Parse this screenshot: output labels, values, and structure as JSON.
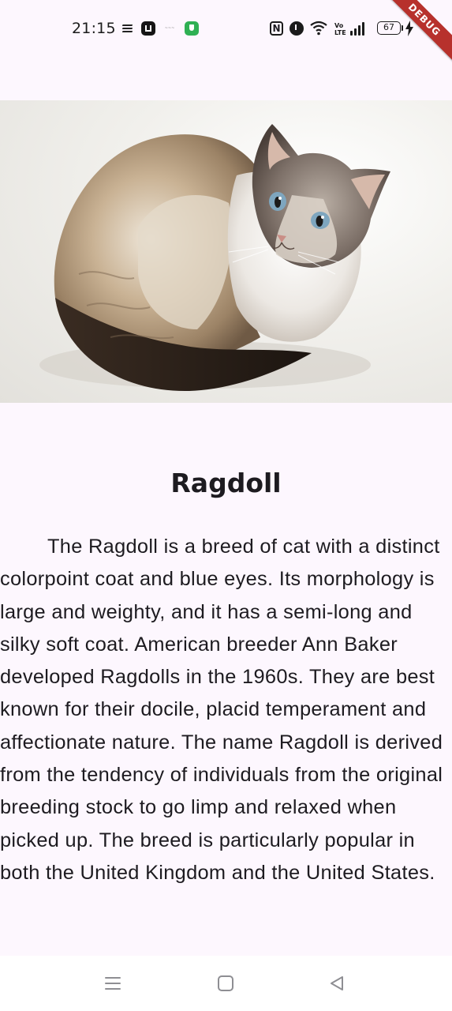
{
  "status_bar": {
    "time": "21:15",
    "battery": "67",
    "volte": "Vo LTE",
    "icons": [
      "notification-lines-icon",
      "app-notification-icon",
      "app-notification-icon",
      "shield-app-icon",
      "nfc-icon",
      "alarm-icon",
      "wifi-icon",
      "volte-icon",
      "signal-icon",
      "battery-icon",
      "charging-icon"
    ]
  },
  "debug_banner": "DEBUG",
  "hero": {
    "image": "ragdoll-cat-photo"
  },
  "breed": {
    "title": "Ragdoll",
    "description": "The Ragdoll is a breed of cat with a distinct colorpoint coat and blue eyes. Its morphology is large and weighty, and it has a semi-long and silky soft coat. American breeder Ann Baker developed Ragdolls in the 1960s. They are best known for their docile, placid temperament and affectionate nature. The name Ragdoll is derived from the tendency of individuals from the original breeding stock to go limp and relaxed when picked up. The breed is particularly popular in both the United Kingdom and the United States."
  },
  "nav_bar": {
    "buttons": [
      "menu-icon",
      "home-icon",
      "back-icon"
    ]
  },
  "colors": {
    "background": "#fdf7fe",
    "text": "#1d1b20",
    "debug_ribbon": "#b7312c"
  }
}
